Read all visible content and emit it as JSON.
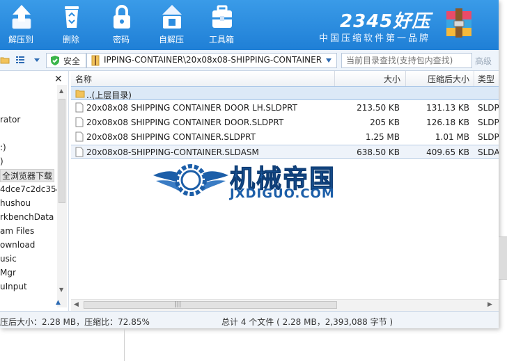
{
  "toolbar": {
    "buttons": [
      {
        "label": "解压到",
        "icon": "extract-icon"
      },
      {
        "label": "删除",
        "icon": "recycle-bin-icon"
      },
      {
        "label": "密码",
        "icon": "lock-icon"
      },
      {
        "label": "自解压",
        "icon": "self-extract-icon"
      },
      {
        "label": "工具箱",
        "icon": "toolbox-icon"
      }
    ]
  },
  "brand": {
    "title": "2345好压",
    "subtitle": "中国压缩软件第一品牌"
  },
  "address": {
    "secure_label": "安全",
    "path": "IPPING-CONTAINER\\20x08x08-SHIPPING-CONTAINER",
    "search_placeholder": "当前目录查找(支持包内查找)",
    "advanced_label": "高级"
  },
  "tree": {
    "items": [
      "rator",
      ":)",
      ")",
      "全浏览器下载",
      "4dce7c2dc354",
      "hushou",
      "rkbenchData",
      "am Files",
      "ownload",
      "usic",
      "Mgr",
      "uInput"
    ]
  },
  "columns": {
    "name": "名称",
    "size": "大小",
    "packed": "压缩后大小",
    "type": "类型"
  },
  "parent_row": {
    "name": "..(上层目录)"
  },
  "files": [
    {
      "name": "20x08x08 SHIPPING CONTAINER DOOR LH.SLDPRT",
      "size": "213.50 KB",
      "packed": "131.13 KB",
      "type": "SLDP"
    },
    {
      "name": "20x08x08 SHIPPING CONTAINER DOOR.SLDPRT",
      "size": "205 KB",
      "packed": "126.18 KB",
      "type": "SLDP"
    },
    {
      "name": "20x08x08 SHIPPING CONTAINER.SLDPRT",
      "size": "1.25 MB",
      "packed": "1.01 MB",
      "type": "SLDP"
    },
    {
      "name": "20x08x08-SHIPPING-CONTAINER.SLDASM",
      "size": "638.50 KB",
      "packed": "409.65 KB",
      "type": "SLDA"
    }
  ],
  "status": {
    "left": "压后大小：2.28 MB，压缩比：72.85%",
    "right": "总计 4 个文件 ( 2.28 MB，2,393,088 字节 )"
  },
  "watermark": {
    "cn": "机械帝国",
    "en": "JXDIGUO.COM"
  },
  "colors": {
    "toolbar": "#2b8de0",
    "selection": "#dce9f7",
    "watermark": "#1c5ea8"
  }
}
